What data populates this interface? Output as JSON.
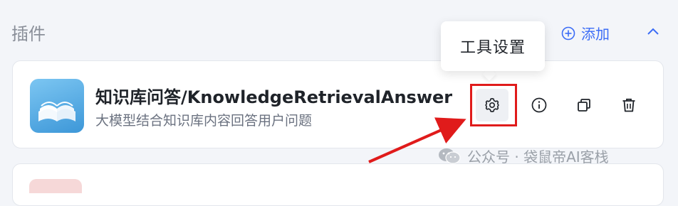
{
  "section": {
    "title": "插件"
  },
  "header": {
    "add_label": "添加"
  },
  "tooltip": {
    "text": "工具设置"
  },
  "plugin": {
    "name": "知识库问答/KnowledgeRetrievalAnswer",
    "description": "大模型结合知识库内容回答用户问题"
  },
  "actions": {
    "settings_icon": "gear-icon",
    "info_icon": "info-icon",
    "copy_icon": "copy-icon",
    "delete_icon": "trash-icon"
  },
  "watermark": {
    "text": "公众号 · 袋鼠帝AI客栈"
  },
  "colors": {
    "accent": "#3b6cf6",
    "highlight": "#e01b1b",
    "background": "#f3f5f9"
  }
}
